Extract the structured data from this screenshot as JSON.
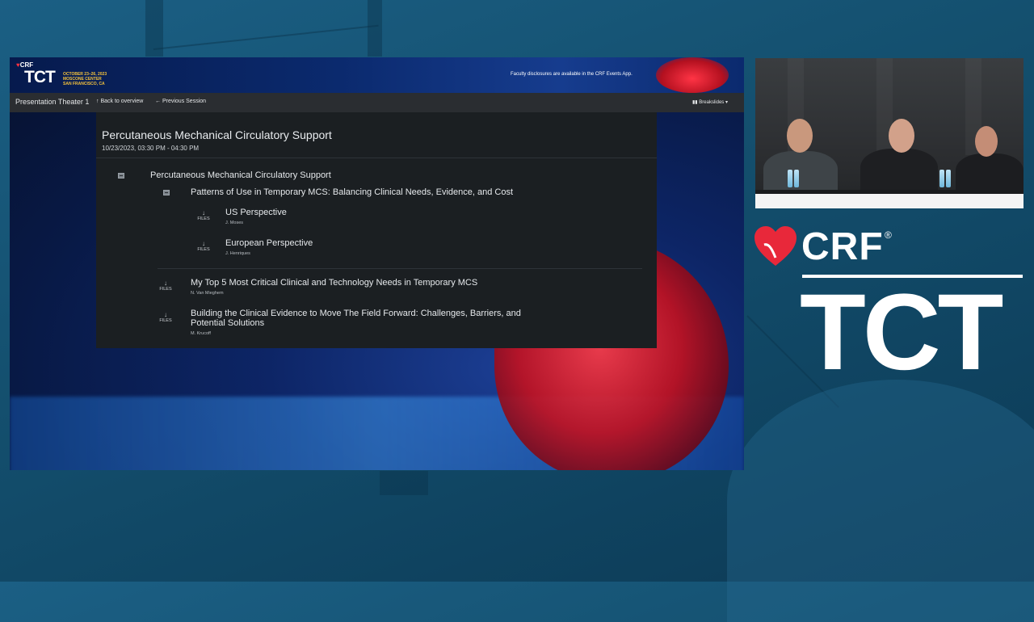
{
  "banner": {
    "logo_crf": "CRF",
    "logo_tct": "TCT",
    "logo_dates": "OCTOBER 23–26, 2023",
    "logo_venue": "MOSCONE CENTER",
    "logo_city": "SAN FRANCISCO, CA",
    "disclosure": "Faculty disclosures are available in the CRF Events App."
  },
  "nav": {
    "theater": "Presentation Theater 1",
    "back": "Back to overview",
    "previous": "Previous Session",
    "breakslides": "Breakslides"
  },
  "session": {
    "title": "Percutaneous Mechanical Circulatory Support",
    "time": "10/23/2023, 03:30 PM - 04:30 PM"
  },
  "agenda": {
    "group_title": "Percutaneous Mechanical Circulatory Support",
    "subgroup_title": "Patterns of Use in Temporary MCS: Balancing Clinical Needs, Evidence, and Cost",
    "files_label": "FILES",
    "talks": [
      {
        "title": "US Perspective",
        "author": "J. Moses"
      },
      {
        "title": "European Perspective",
        "author": "J. Henriques"
      },
      {
        "title": "My Top 5 Most Critical Clinical and Technology Needs in Temporary MCS",
        "author": "N. Van Mieghem"
      },
      {
        "title": "Building the Clinical Evidence to Move The Field Forward: Challenges, Barriers, and Potential Solutions",
        "author": "M. Krucoff"
      }
    ]
  },
  "brand": {
    "crf": "CRF",
    "registered": "®",
    "tct": "TCT"
  },
  "icons": {
    "arrow_up": "↑",
    "arrow_left": "←",
    "arrow_down": "↓",
    "columns": "▮▮",
    "caret": "▾",
    "heart": "♥"
  },
  "colors": {
    "background": "#14506f",
    "panel": "#1b1f22",
    "navbar": "#2a2d31",
    "brand_red": "#e8283a",
    "banner_gold": "#f4c23c"
  }
}
